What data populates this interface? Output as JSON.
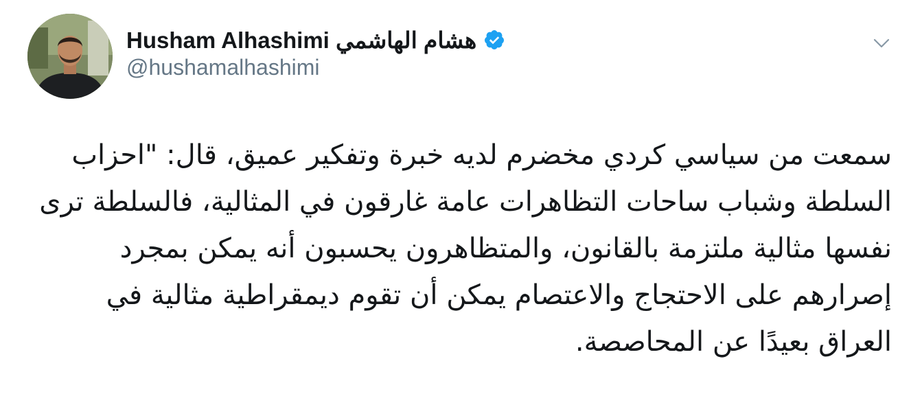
{
  "author": {
    "display_name": "Husham Alhashimi هشام الهاشمي",
    "handle": "@hushamalhashimi",
    "verified": true,
    "avatar_icon": "profile-photo"
  },
  "tweet": {
    "text": "سمعت من سياسي كردي مخضرم لديه خبرة وتفكير عميق، قال: \"احزاب السلطة وشباب ساحات التظاهرات عامة غارقون في المثالية، فالسلطة ترى نفسها مثالية ملتزمة بالقانون، والمتظاهرون يحسبون أنه يمكن بمجرد إصرارهم على الاحتجاج والاعتصام يمكن أن تقوم ديمقراطية مثالية في العراق بعيدًا عن المحاصصة."
  },
  "colors": {
    "verified_badge": "#1da1f2",
    "handle_gray": "#657786",
    "text": "#14171a"
  },
  "icons": {
    "menu": "chevron-down-icon",
    "badge": "verified-badge-icon"
  }
}
